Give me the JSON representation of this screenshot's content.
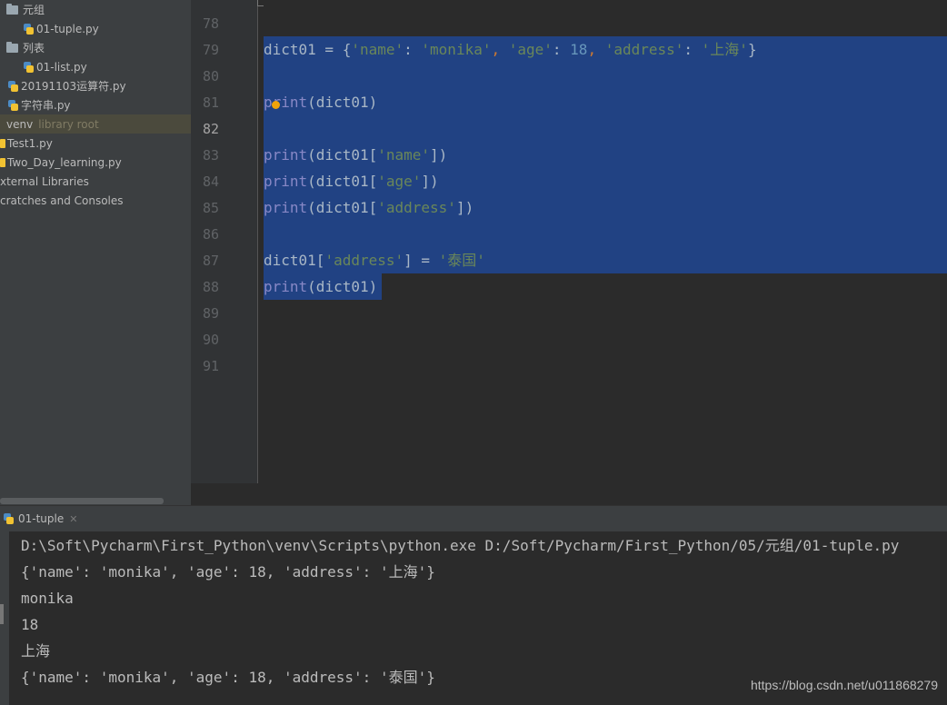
{
  "project_tree": [
    {
      "label": "元组",
      "icon": "folder-icon",
      "selected": false
    },
    {
      "label": "01-tuple.py",
      "icon": "python-file-icon",
      "selected": false
    },
    {
      "label": "列表",
      "icon": "folder-icon",
      "selected": false
    },
    {
      "label": "01-list.py",
      "icon": "python-file-icon",
      "selected": false
    },
    {
      "label": "20191103运算符.py",
      "icon": "python-file-icon",
      "selected": false
    },
    {
      "label": "字符串.py",
      "icon": "python-file-icon",
      "selected": false
    },
    {
      "label": "venv",
      "hint": "library root",
      "icon": "library-folder-icon",
      "selected": true
    },
    {
      "label": "Test1.py",
      "icon": "python-file-icon",
      "selected": false
    },
    {
      "label": "Two_Day_learning.py",
      "icon": "python-file-icon",
      "selected": false
    },
    {
      "label": "xternal Libraries",
      "icon": "",
      "selected": false
    },
    {
      "label": "cratches and Consoles",
      "icon": "",
      "selected": false
    }
  ],
  "editor": {
    "line_numbers": [
      "78",
      "79",
      "80",
      "81",
      "82",
      "83",
      "84",
      "85",
      "86",
      "87",
      "88",
      "89",
      "90",
      "91"
    ],
    "selected_lines": [
      "79",
      "80",
      "81",
      "82",
      "83",
      "84",
      "85",
      "86",
      "87"
    ],
    "code": {
      "l79_var": "dict01",
      "l79_eq": " = ",
      "l79_ob": "{",
      "l79_k1": "'name'",
      "l79_c1": ": ",
      "l79_v1": "'monika'",
      "l79_s1": ", ",
      "l79_k2": "'age'",
      "l79_c2": ": ",
      "l79_v2": "18",
      "l79_s2": ", ",
      "l79_k3": "'address'",
      "l79_c3": ": ",
      "l79_v3": "'上海'",
      "l79_cb": "}",
      "l81_fn": "print",
      "l81_rest": "(dict01)",
      "l83_fn": "print",
      "l83_a": "(dict01[",
      "l83_k": "'name'",
      "l83_b": "])",
      "l84_fn": "print",
      "l84_a": "(dict01[",
      "l84_k": "'age'",
      "l84_b": "])",
      "l85_fn": "print",
      "l85_a": "(dict01[",
      "l85_k": "'address'",
      "l85_b": "])",
      "l87_a": "dict01[",
      "l87_k": "'address'",
      "l87_b": "] = ",
      "l87_v": "'泰国'",
      "l88_fn": "print",
      "l88_rest": "(dict01)"
    }
  },
  "run_panel": {
    "tab_label": "01-tuple",
    "tab_icon": "python-run-icon",
    "output": [
      "D:\\Soft\\Pycharm\\First_Python\\venv\\Scripts\\python.exe D:/Soft/Pycharm/First_Python/05/元组/01-tuple.py",
      "{'name': 'monika', 'age': 18, 'address': '上海'}",
      "monika",
      "18",
      "上海",
      "{'name': 'monika', 'age': 18, 'address': '泰国'}"
    ]
  },
  "watermark": "https://blog.csdn.net/u011868279",
  "colors": {
    "selection": "#214283",
    "keyword_builtin": "#8888c6",
    "string": "#6a8759",
    "number": "#6897bb"
  }
}
